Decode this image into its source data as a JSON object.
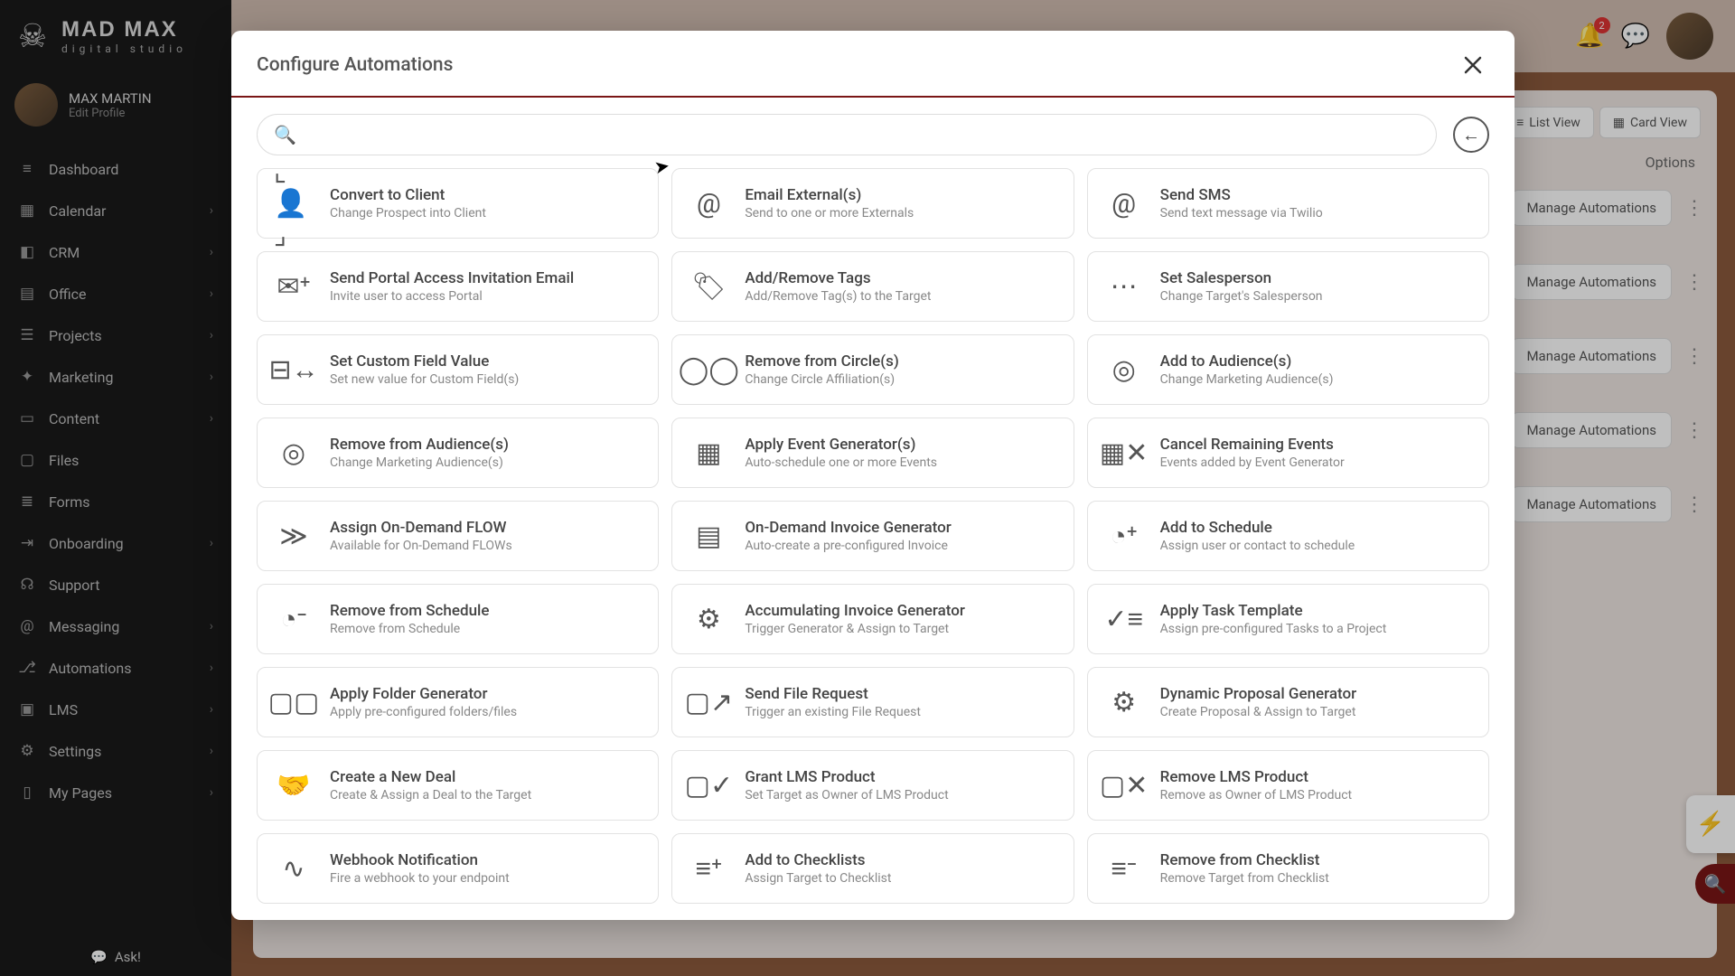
{
  "brand": {
    "main": "MAD MAX",
    "sub": "digital studio"
  },
  "profile": {
    "name": "MAX MARTIN",
    "edit": "Edit Profile"
  },
  "nav": [
    {
      "label": "Dashboard",
      "icon": "≡",
      "chev": false
    },
    {
      "label": "Calendar",
      "icon": "▦",
      "chev": true
    },
    {
      "label": "CRM",
      "icon": "◧",
      "chev": true
    },
    {
      "label": "Office",
      "icon": "▤",
      "chev": true
    },
    {
      "label": "Projects",
      "icon": "☰",
      "chev": true
    },
    {
      "label": "Marketing",
      "icon": "✦",
      "chev": true
    },
    {
      "label": "Content",
      "icon": "▭",
      "chev": true
    },
    {
      "label": "Files",
      "icon": "▢",
      "chev": false
    },
    {
      "label": "Forms",
      "icon": "≣",
      "chev": false
    },
    {
      "label": "Onboarding",
      "icon": "⇥",
      "chev": true
    },
    {
      "label": "Support",
      "icon": "☊",
      "chev": false
    },
    {
      "label": "Messaging",
      "icon": "@",
      "chev": true
    },
    {
      "label": "Automations",
      "icon": "⎇",
      "chev": true
    },
    {
      "label": "LMS",
      "icon": "▣",
      "chev": true
    },
    {
      "label": "Settings",
      "icon": "⚙",
      "chev": true
    },
    {
      "label": "My Pages",
      "icon": "▯",
      "chev": true
    }
  ],
  "ask": "Ask!",
  "topbar": {
    "badge": "2"
  },
  "bg": {
    "list_view": "List View",
    "card_view": "Card View",
    "options": "Options",
    "manage": "Manage Automations"
  },
  "modal": {
    "title": "Configure Automations",
    "search_placeholder": "",
    "cards": [
      {
        "title": "Convert to Client",
        "sub": "Change Prospect into Client",
        "icon": "⌞👤⌟"
      },
      {
        "title": "Email External(s)",
        "sub": "Send to one or more Externals",
        "icon": "@"
      },
      {
        "title": "Send SMS",
        "sub": "Send text message via Twilio",
        "icon": "@"
      },
      {
        "title": "Send Portal Access Invitation Email",
        "sub": "Invite user to access Portal",
        "icon": "✉⁺"
      },
      {
        "title": "Add/Remove Tags",
        "sub": "Add/Remove Tag(s) to the Target",
        "icon": "🏷"
      },
      {
        "title": "Set Salesperson",
        "sub": "Change Target's Salesperson",
        "icon": "⋯"
      },
      {
        "title": "Set Custom Field Value",
        "sub": "Set new value for Custom Field(s)",
        "icon": "⊟↔"
      },
      {
        "title": "Remove from Circle(s)",
        "sub": "Change Circle Affiliation(s)",
        "icon": "◯◯"
      },
      {
        "title": "Add to Audience(s)",
        "sub": "Change Marketing Audience(s)",
        "icon": "◎"
      },
      {
        "title": "Remove from Audience(s)",
        "sub": "Change Marketing Audience(s)",
        "icon": "◎"
      },
      {
        "title": "Apply Event Generator(s)",
        "sub": "Auto-schedule one or more Events",
        "icon": "▦"
      },
      {
        "title": "Cancel Remaining Events",
        "sub": "Events added by Event Generator",
        "icon": "▦✕"
      },
      {
        "title": "Assign On-Demand FLOW",
        "sub": "Available for On-Demand FLOWs",
        "icon": "≫"
      },
      {
        "title": "On-Demand Invoice Generator",
        "sub": "Auto-create a pre-configured Invoice",
        "icon": "▤"
      },
      {
        "title": "Add to Schedule",
        "sub": "Assign user or contact to schedule",
        "icon": "◔⁺"
      },
      {
        "title": "Remove from Schedule",
        "sub": "Remove from Schedule",
        "icon": "◔⁻"
      },
      {
        "title": "Accumulating Invoice Generator",
        "sub": "Trigger Generator & Assign to Target",
        "icon": "⚙"
      },
      {
        "title": "Apply Task Template",
        "sub": "Assign pre-configured Tasks to a Project",
        "icon": "✓≡"
      },
      {
        "title": "Apply Folder Generator",
        "sub": "Apply pre-configured folders/files",
        "icon": "▢▢"
      },
      {
        "title": "Send File Request",
        "sub": "Trigger an existing File Request",
        "icon": "▢↗"
      },
      {
        "title": "Dynamic Proposal Generator",
        "sub": "Create Proposal & Assign to Target",
        "icon": "⚙"
      },
      {
        "title": "Create a New Deal",
        "sub": "Create & Assign a Deal to the Target",
        "icon": "🤝"
      },
      {
        "title": "Grant LMS Product",
        "sub": "Set Target as Owner of LMS Product",
        "icon": "▢✓"
      },
      {
        "title": "Remove LMS Product",
        "sub": "Remove as Owner of LMS Product",
        "icon": "▢✕"
      },
      {
        "title": "Webhook Notification",
        "sub": "Fire a webhook to your endpoint",
        "icon": "∿"
      },
      {
        "title": "Add to Checklists",
        "sub": "Assign Target to Checklist",
        "icon": "≡⁺"
      },
      {
        "title": "Remove from Checklist",
        "sub": "Remove Target from Checklist",
        "icon": "≡⁻"
      }
    ]
  }
}
